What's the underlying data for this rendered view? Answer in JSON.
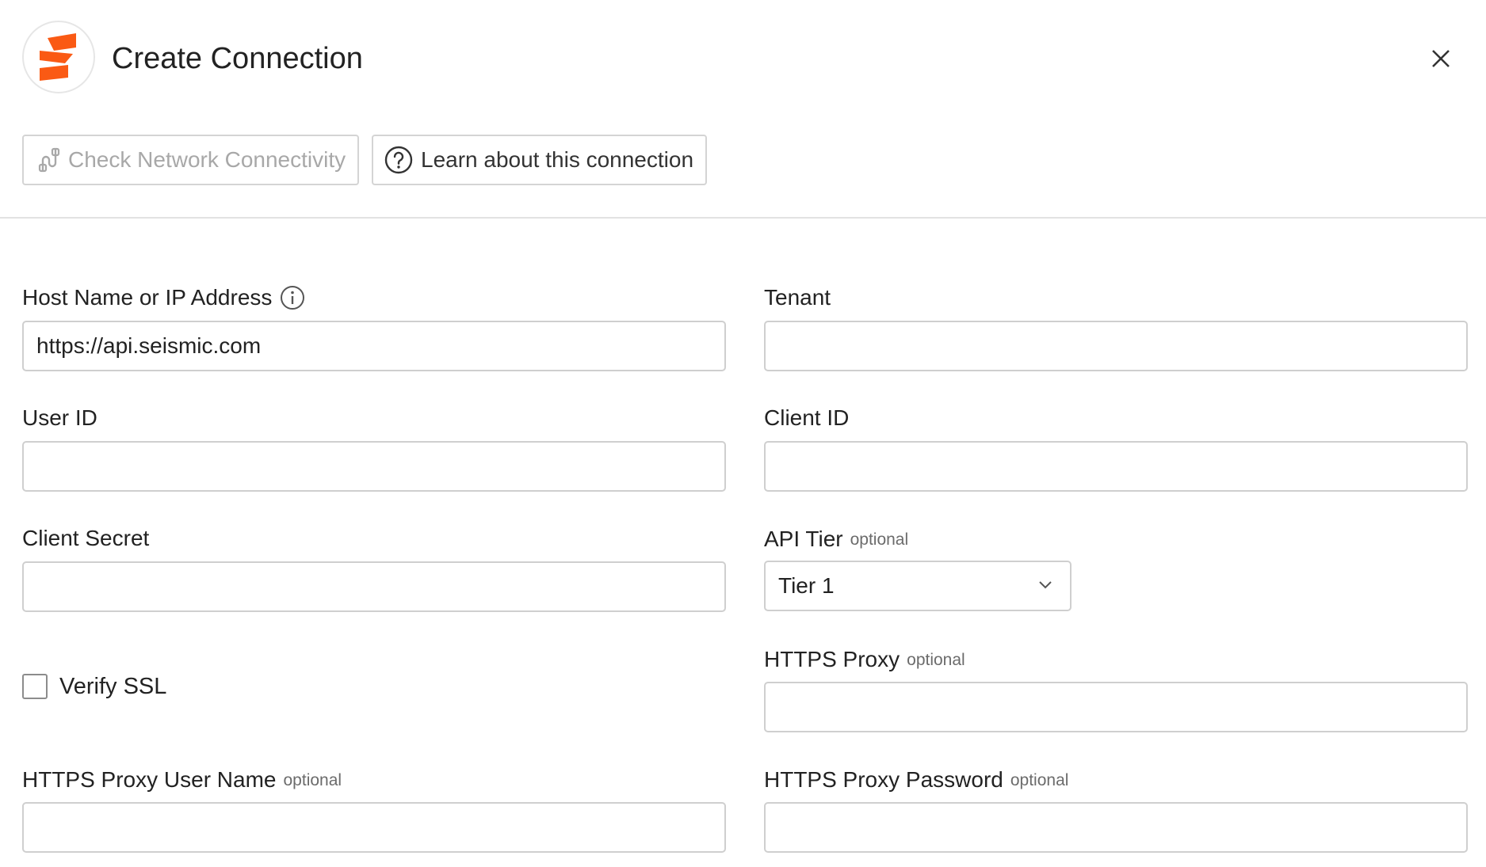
{
  "dialog": {
    "title": "Create Connection",
    "brand_color": "#fa5a14"
  },
  "toolbar": {
    "check_connectivity_label": "Check Network Connectivity",
    "learn_label": "Learn about this connection"
  },
  "form": {
    "host": {
      "label": "Host Name or IP Address",
      "value": "https://api.seismic.com"
    },
    "tenant": {
      "label": "Tenant",
      "value": ""
    },
    "user_id": {
      "label": "User ID",
      "value": ""
    },
    "client_id": {
      "label": "Client ID",
      "value": ""
    },
    "client_secret": {
      "label": "Client Secret",
      "value": ""
    },
    "api_tier": {
      "label": "API Tier",
      "optional": "optional",
      "selected": "Tier 1"
    },
    "verify_ssl": {
      "label": "Verify SSL",
      "checked": false
    },
    "https_proxy": {
      "label": "HTTPS Proxy",
      "optional": "optional",
      "value": ""
    },
    "proxy_user": {
      "label": "HTTPS Proxy User Name",
      "optional": "optional",
      "value": ""
    },
    "proxy_password": {
      "label": "HTTPS Proxy Password",
      "optional": "optional",
      "value": ""
    }
  },
  "icons": {
    "logo": "seismic-logo-icon",
    "close": "close-icon",
    "connectivity": "network-connectivity-icon",
    "help": "question-circle-icon",
    "info": "info-icon",
    "dropdown": "chevron-down-icon"
  }
}
